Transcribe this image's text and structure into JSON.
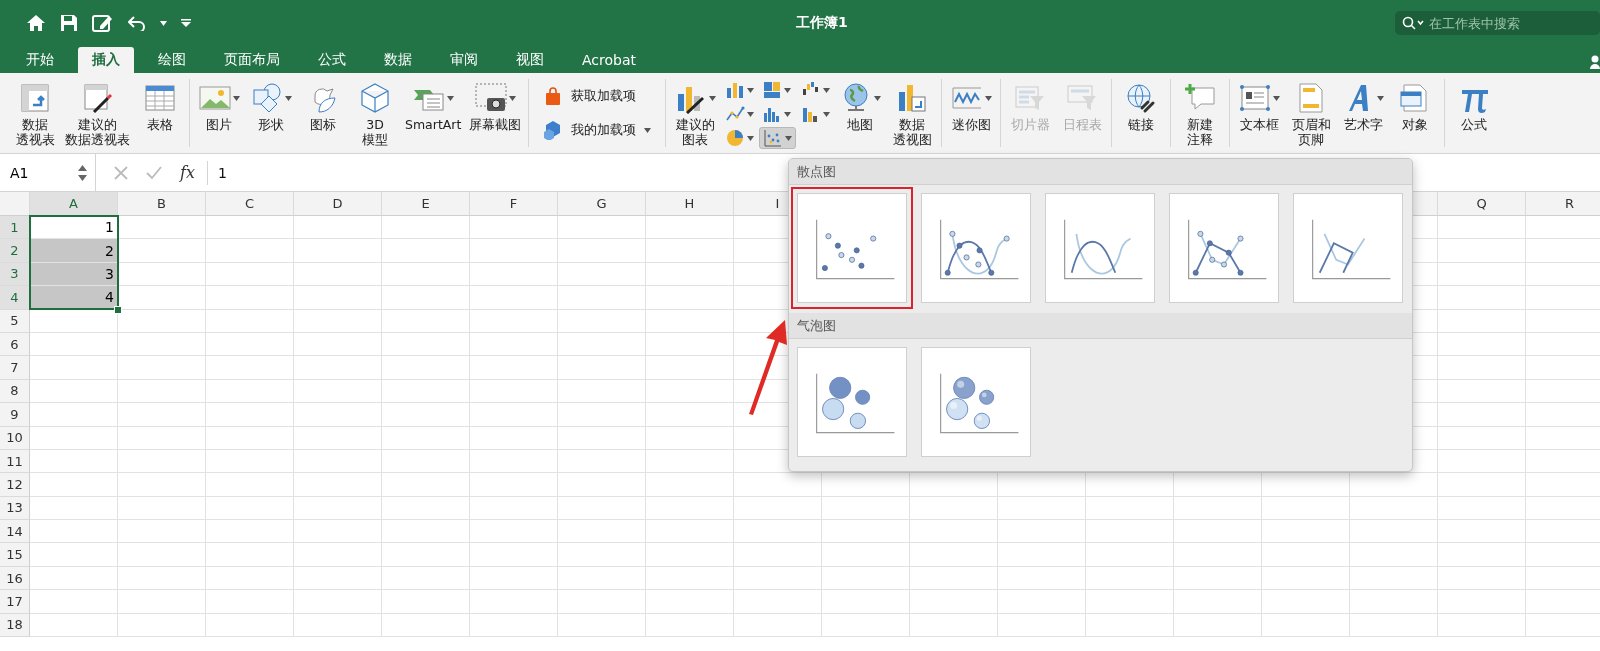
{
  "title_bar": {
    "title": "工作簿1",
    "search": {
      "placeholder": "在工作表中搜索"
    }
  },
  "tabs": [
    {
      "label": "开始",
      "selected": false
    },
    {
      "label": "插入",
      "selected": true
    },
    {
      "label": "绘图",
      "selected": false
    },
    {
      "label": "页面布局",
      "selected": false
    },
    {
      "label": "公式",
      "selected": false
    },
    {
      "label": "数据",
      "selected": false
    },
    {
      "label": "审阅",
      "selected": false
    },
    {
      "label": "视图",
      "selected": false
    },
    {
      "label": "Acrobat",
      "selected": false
    }
  ],
  "ribbon": {
    "groups": [
      {
        "items": [
          {
            "kind": "large",
            "lines": [
              "数据",
              "透视表"
            ]
          },
          {
            "kind": "large",
            "lines": [
              "建议的",
              "数据透视表"
            ]
          },
          {
            "kind": "large",
            "lines": [
              "表格"
            ]
          }
        ]
      },
      {
        "items": [
          {
            "kind": "large",
            "lines": [
              "图片"
            ],
            "dropdown": true
          },
          {
            "kind": "large",
            "lines": [
              "形状"
            ],
            "dropdown": true
          },
          {
            "kind": "large",
            "lines": [
              "图标"
            ]
          },
          {
            "kind": "large",
            "lines": [
              "3D",
              "模型"
            ]
          },
          {
            "kind": "large",
            "lines": [
              "SmartArt"
            ],
            "dropdown": true
          },
          {
            "kind": "large",
            "lines": [
              "屏幕截图"
            ],
            "dropdown": true
          }
        ]
      },
      {
        "items": [
          {
            "kind": "small",
            "label": "获取加载项"
          },
          {
            "kind": "small",
            "label": "我的加载项",
            "dropdown": true
          }
        ]
      },
      {
        "items": [
          {
            "kind": "large",
            "lines": [
              "建议的",
              "图表"
            ],
            "dropdown": true
          },
          {
            "kind": "stack",
            "buttons": [
              {
                "pressed": false
              },
              {
                "pressed": false
              },
              {
                "pressed": false
              }
            ]
          },
          {
            "kind": "stack",
            "buttons": [
              {
                "pressed": false
              },
              {
                "pressed": false
              },
              {
                "pressed": true
              }
            ]
          },
          {
            "kind": "stack",
            "buttons": [
              {
                "pressed": false
              },
              {
                "pressed": false
              }
            ]
          },
          {
            "kind": "large",
            "lines": [
              "地图"
            ],
            "dropdown": true
          },
          {
            "kind": "large",
            "lines": [
              "数据",
              "透视图"
            ]
          }
        ]
      },
      {
        "items": [
          {
            "kind": "large",
            "lines": [
              "迷你图"
            ],
            "dropdown": true
          }
        ]
      },
      {
        "items": [
          {
            "kind": "large",
            "lines": [
              "切片器"
            ],
            "disabled": true
          },
          {
            "kind": "large",
            "lines": [
              "日程表"
            ],
            "disabled": true
          }
        ]
      },
      {
        "items": [
          {
            "kind": "large",
            "lines": [
              "链接"
            ],
            "disabled": false
          }
        ]
      },
      {
        "items": [
          {
            "kind": "large",
            "lines": [
              "新建",
              "注释"
            ],
            "disabled": false
          }
        ]
      },
      {
        "items": [
          {
            "kind": "large",
            "lines": [
              "文本框"
            ],
            "dropdown": true
          },
          {
            "kind": "large",
            "lines": [
              "页眉和",
              "页脚"
            ]
          },
          {
            "kind": "large",
            "lines": [
              "艺术字"
            ],
            "dropdown": true
          },
          {
            "kind": "large",
            "lines": [
              "对象"
            ]
          }
        ]
      },
      {
        "items": [
          {
            "kind": "large",
            "lines": [
              "公式"
            ]
          }
        ]
      }
    ]
  },
  "formula_bar": {
    "name_box": "A1",
    "function_button": "fx",
    "formula": "1"
  },
  "sheet": {
    "columns": [
      {
        "label": "A",
        "highlighted": true
      },
      {
        "label": "B",
        "highlighted": false
      },
      {
        "label": "C",
        "highlighted": false
      },
      {
        "label": "D",
        "highlighted": false
      },
      {
        "label": "E",
        "highlighted": false
      },
      {
        "label": "F",
        "highlighted": false
      },
      {
        "label": "G",
        "highlighted": false
      },
      {
        "label": "H",
        "highlighted": false
      },
      {
        "label": "I",
        "highlighted": false
      },
      {},
      {},
      {},
      {},
      {},
      {},
      {},
      {
        "label": "Q",
        "highlighted": false
      },
      {
        "label": "R",
        "highlighted": false
      }
    ],
    "rows": [
      {
        "header": "1",
        "highlighted": true,
        "cells": [
          {
            "value": "1",
            "selected": true,
            "active": true
          }
        ]
      },
      {
        "header": "2",
        "highlighted": true,
        "cells": [
          {
            "value": "2",
            "selected": true,
            "active": false
          }
        ]
      },
      {
        "header": "3",
        "highlighted": true,
        "cells": [
          {
            "value": "3",
            "selected": true,
            "active": false
          }
        ]
      },
      {
        "header": "4",
        "highlighted": true,
        "cells": [
          {
            "value": "4",
            "selected": true,
            "active": false
          }
        ]
      },
      {
        "header": "5",
        "highlighted": false
      },
      {
        "header": "6",
        "highlighted": false
      },
      {
        "header": "7",
        "highlighted": false
      },
      {
        "header": "8",
        "highlighted": false
      },
      {
        "header": "9",
        "highlighted": false
      },
      {
        "header": "10",
        "highlighted": false
      },
      {
        "header": "11",
        "highlighted": false
      },
      {
        "header": "12",
        "highlighted": false
      },
      {
        "header": "13",
        "highlighted": false
      },
      {
        "header": "14",
        "highlighted": false
      },
      {
        "header": "15",
        "highlighted": false
      },
      {
        "header": "16",
        "highlighted": false
      },
      {
        "header": "17",
        "highlighted": false
      },
      {
        "header": "18",
        "highlighted": false
      }
    ]
  },
  "chart_menu": {
    "sections": [
      {
        "title": "散点图",
        "charts": [
          {
            "kind": "scatter",
            "selected": true
          },
          {
            "kind": "smooth-markers",
            "selected": false
          },
          {
            "kind": "smooth",
            "selected": false
          },
          {
            "kind": "straight-markers",
            "selected": false
          },
          {
            "kind": "straight",
            "selected": false
          }
        ]
      },
      {
        "title": "气泡图",
        "charts": [
          {
            "kind": "bubble",
            "selected": false
          },
          {
            "kind": "bubble-3d",
            "selected": false
          }
        ]
      }
    ]
  },
  "pointer_arrow": true
}
